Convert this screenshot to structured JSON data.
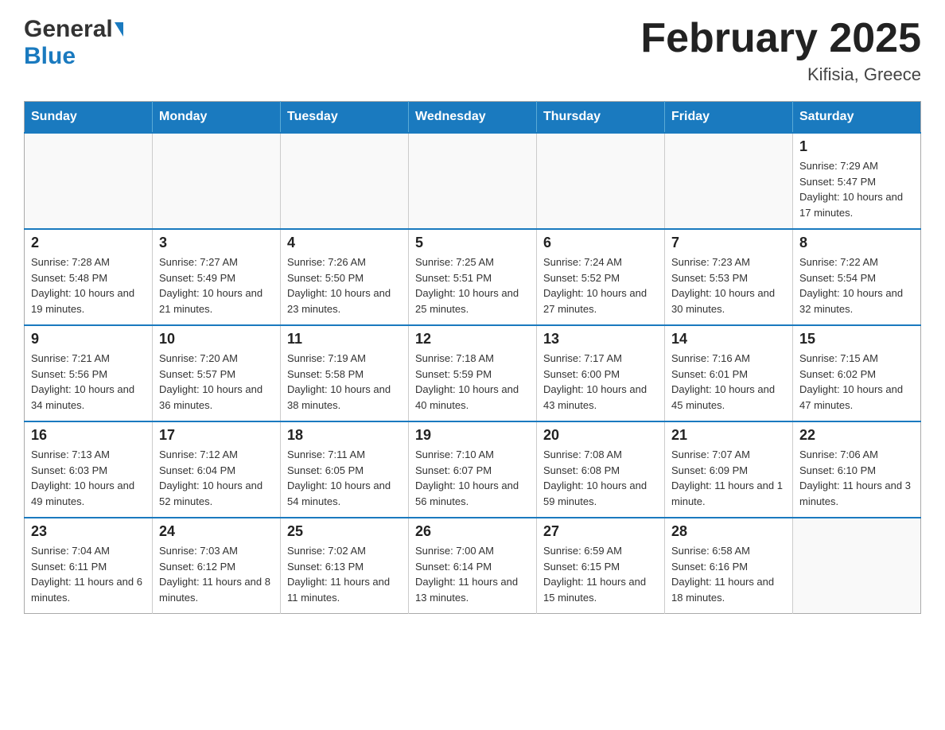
{
  "header": {
    "logo_general": "General",
    "logo_blue": "Blue",
    "title": "February 2025",
    "subtitle": "Kifisia, Greece"
  },
  "days_of_week": [
    "Sunday",
    "Monday",
    "Tuesday",
    "Wednesday",
    "Thursday",
    "Friday",
    "Saturday"
  ],
  "weeks": [
    [
      {
        "num": "",
        "info": ""
      },
      {
        "num": "",
        "info": ""
      },
      {
        "num": "",
        "info": ""
      },
      {
        "num": "",
        "info": ""
      },
      {
        "num": "",
        "info": ""
      },
      {
        "num": "",
        "info": ""
      },
      {
        "num": "1",
        "info": "Sunrise: 7:29 AM\nSunset: 5:47 PM\nDaylight: 10 hours and 17 minutes."
      }
    ],
    [
      {
        "num": "2",
        "info": "Sunrise: 7:28 AM\nSunset: 5:48 PM\nDaylight: 10 hours and 19 minutes."
      },
      {
        "num": "3",
        "info": "Sunrise: 7:27 AM\nSunset: 5:49 PM\nDaylight: 10 hours and 21 minutes."
      },
      {
        "num": "4",
        "info": "Sunrise: 7:26 AM\nSunset: 5:50 PM\nDaylight: 10 hours and 23 minutes."
      },
      {
        "num": "5",
        "info": "Sunrise: 7:25 AM\nSunset: 5:51 PM\nDaylight: 10 hours and 25 minutes."
      },
      {
        "num": "6",
        "info": "Sunrise: 7:24 AM\nSunset: 5:52 PM\nDaylight: 10 hours and 27 minutes."
      },
      {
        "num": "7",
        "info": "Sunrise: 7:23 AM\nSunset: 5:53 PM\nDaylight: 10 hours and 30 minutes."
      },
      {
        "num": "8",
        "info": "Sunrise: 7:22 AM\nSunset: 5:54 PM\nDaylight: 10 hours and 32 minutes."
      }
    ],
    [
      {
        "num": "9",
        "info": "Sunrise: 7:21 AM\nSunset: 5:56 PM\nDaylight: 10 hours and 34 minutes."
      },
      {
        "num": "10",
        "info": "Sunrise: 7:20 AM\nSunset: 5:57 PM\nDaylight: 10 hours and 36 minutes."
      },
      {
        "num": "11",
        "info": "Sunrise: 7:19 AM\nSunset: 5:58 PM\nDaylight: 10 hours and 38 minutes."
      },
      {
        "num": "12",
        "info": "Sunrise: 7:18 AM\nSunset: 5:59 PM\nDaylight: 10 hours and 40 minutes."
      },
      {
        "num": "13",
        "info": "Sunrise: 7:17 AM\nSunset: 6:00 PM\nDaylight: 10 hours and 43 minutes."
      },
      {
        "num": "14",
        "info": "Sunrise: 7:16 AM\nSunset: 6:01 PM\nDaylight: 10 hours and 45 minutes."
      },
      {
        "num": "15",
        "info": "Sunrise: 7:15 AM\nSunset: 6:02 PM\nDaylight: 10 hours and 47 minutes."
      }
    ],
    [
      {
        "num": "16",
        "info": "Sunrise: 7:13 AM\nSunset: 6:03 PM\nDaylight: 10 hours and 49 minutes."
      },
      {
        "num": "17",
        "info": "Sunrise: 7:12 AM\nSunset: 6:04 PM\nDaylight: 10 hours and 52 minutes."
      },
      {
        "num": "18",
        "info": "Sunrise: 7:11 AM\nSunset: 6:05 PM\nDaylight: 10 hours and 54 minutes."
      },
      {
        "num": "19",
        "info": "Sunrise: 7:10 AM\nSunset: 6:07 PM\nDaylight: 10 hours and 56 minutes."
      },
      {
        "num": "20",
        "info": "Sunrise: 7:08 AM\nSunset: 6:08 PM\nDaylight: 10 hours and 59 minutes."
      },
      {
        "num": "21",
        "info": "Sunrise: 7:07 AM\nSunset: 6:09 PM\nDaylight: 11 hours and 1 minute."
      },
      {
        "num": "22",
        "info": "Sunrise: 7:06 AM\nSunset: 6:10 PM\nDaylight: 11 hours and 3 minutes."
      }
    ],
    [
      {
        "num": "23",
        "info": "Sunrise: 7:04 AM\nSunset: 6:11 PM\nDaylight: 11 hours and 6 minutes."
      },
      {
        "num": "24",
        "info": "Sunrise: 7:03 AM\nSunset: 6:12 PM\nDaylight: 11 hours and 8 minutes."
      },
      {
        "num": "25",
        "info": "Sunrise: 7:02 AM\nSunset: 6:13 PM\nDaylight: 11 hours and 11 minutes."
      },
      {
        "num": "26",
        "info": "Sunrise: 7:00 AM\nSunset: 6:14 PM\nDaylight: 11 hours and 13 minutes."
      },
      {
        "num": "27",
        "info": "Sunrise: 6:59 AM\nSunset: 6:15 PM\nDaylight: 11 hours and 15 minutes."
      },
      {
        "num": "28",
        "info": "Sunrise: 6:58 AM\nSunset: 6:16 PM\nDaylight: 11 hours and 18 minutes."
      },
      {
        "num": "",
        "info": ""
      }
    ]
  ]
}
